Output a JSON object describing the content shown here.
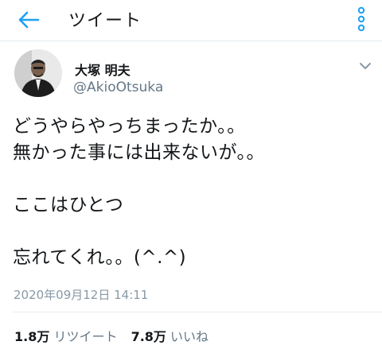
{
  "header": {
    "title": "ツイート",
    "back_icon": "back-arrow-icon",
    "more_icon": "more-vertical-icon",
    "accent": "#1da1f2"
  },
  "author": {
    "display_name": "大塚 明夫",
    "handle": "@AkioOtsuka"
  },
  "tweet": {
    "text": "どうやらやっちまったか。。\n無かった事には出来ないが。。\n\nここはひとつ\n\n忘れてくれ。。(^.^)",
    "timestamp": "2020年09月12日 14:11"
  },
  "stats": {
    "retweets": {
      "count": "1.8万",
      "label": "リツイート"
    },
    "likes": {
      "count": "7.8万",
      "label": "いいね"
    }
  }
}
